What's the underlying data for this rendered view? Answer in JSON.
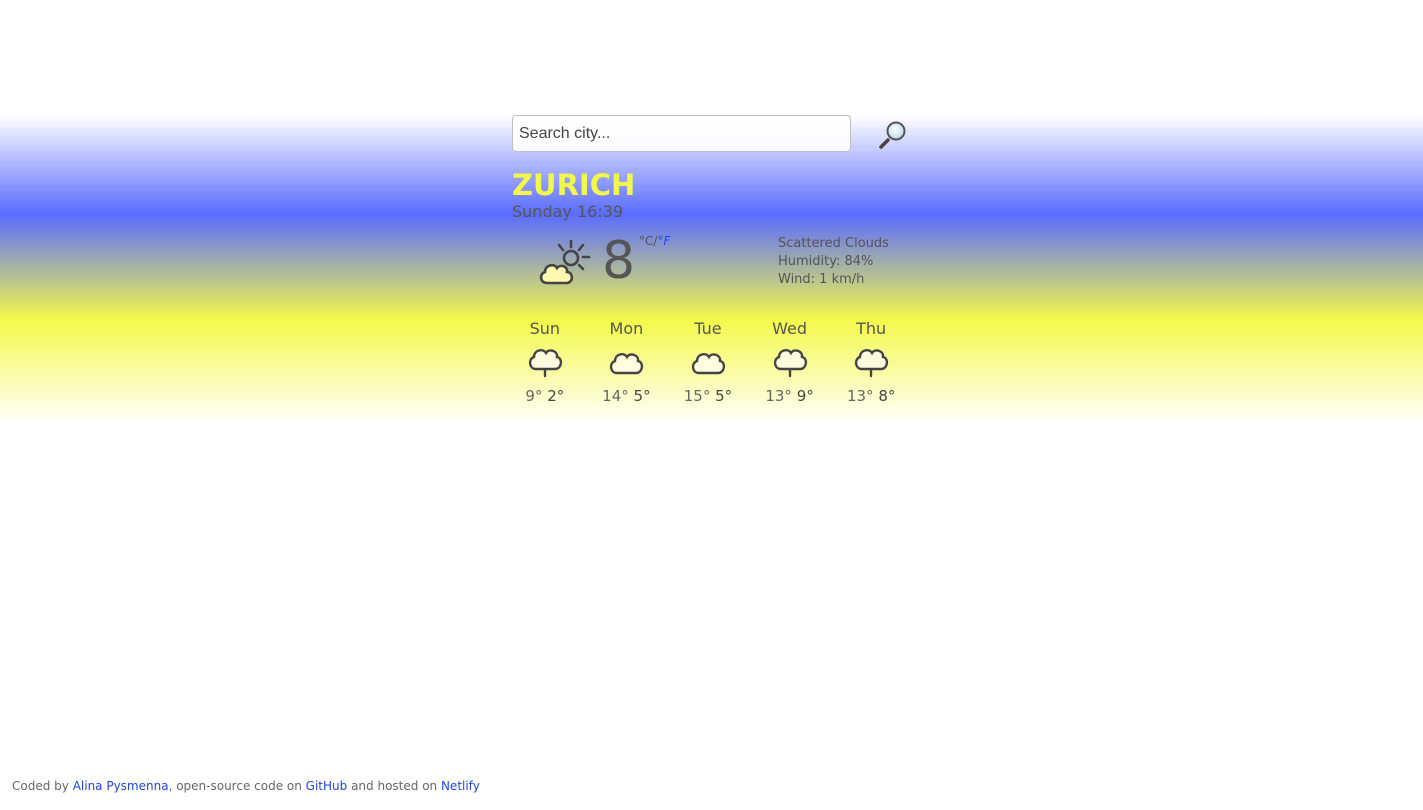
{
  "search": {
    "placeholder": "Search city...",
    "value": "",
    "button_icon": "magnifier-icon"
  },
  "current": {
    "city": "ZURICH",
    "datetime": "Sunday 16:39",
    "icon": "partly-cloudy-icon",
    "temperature": "8",
    "unit_c": "°C",
    "unit_separator": "/",
    "unit_f": "°F",
    "description": "Scattered Clouds",
    "humidity": "Humidity: 84%",
    "wind": "Wind: 1 km/h"
  },
  "forecast": [
    {
      "day": "Sun",
      "icon": "rain-cloud-icon",
      "max": "9°",
      "min": "2°"
    },
    {
      "day": "Mon",
      "icon": "cloud-icon",
      "max": "14°",
      "min": "5°"
    },
    {
      "day": "Tue",
      "icon": "cloud-icon",
      "max": "15°",
      "min": "5°"
    },
    {
      "day": "Wed",
      "icon": "rain-cloud-icon",
      "max": "13°",
      "min": "9°"
    },
    {
      "day": "Thu",
      "icon": "rain-cloud-icon",
      "max": "13°",
      "min": "8°"
    }
  ],
  "footer": {
    "prefix": "Coded by ",
    "author": "Alina Pysmenna",
    "middle": ", open-source code on ",
    "repo": "GitHub",
    "suffix": " and hosted on ",
    "host": "Netlify"
  },
  "colors": {
    "band_top": "#5a6cff",
    "band_bottom": "#f4f94a",
    "city": "#f2f74a",
    "link": "#2244dd"
  }
}
